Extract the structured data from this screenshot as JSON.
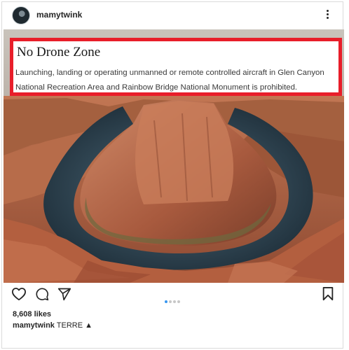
{
  "post": {
    "username": "mamytwink",
    "likes": "8,608 likes",
    "caption_user": "mamytwink",
    "caption_text": "TERRE ▲",
    "carousel": {
      "count": 4,
      "active": 1
    }
  },
  "notice": {
    "title": "No Drone Zone",
    "body": "Launching, landing or operating unmanned or remote controlled aircraft in Glen Canyon National Recreation Area and Rainbow Bridge National Monument is prohibited."
  },
  "icons": {
    "avatar": "avatar",
    "more": "more-options-icon",
    "like": "heart-icon",
    "comment": "comment-icon",
    "share": "paper-plane-icon",
    "save": "bookmark-icon"
  },
  "colors": {
    "notice_border": "#e81e2a",
    "carousel_active": "#3897f0"
  }
}
